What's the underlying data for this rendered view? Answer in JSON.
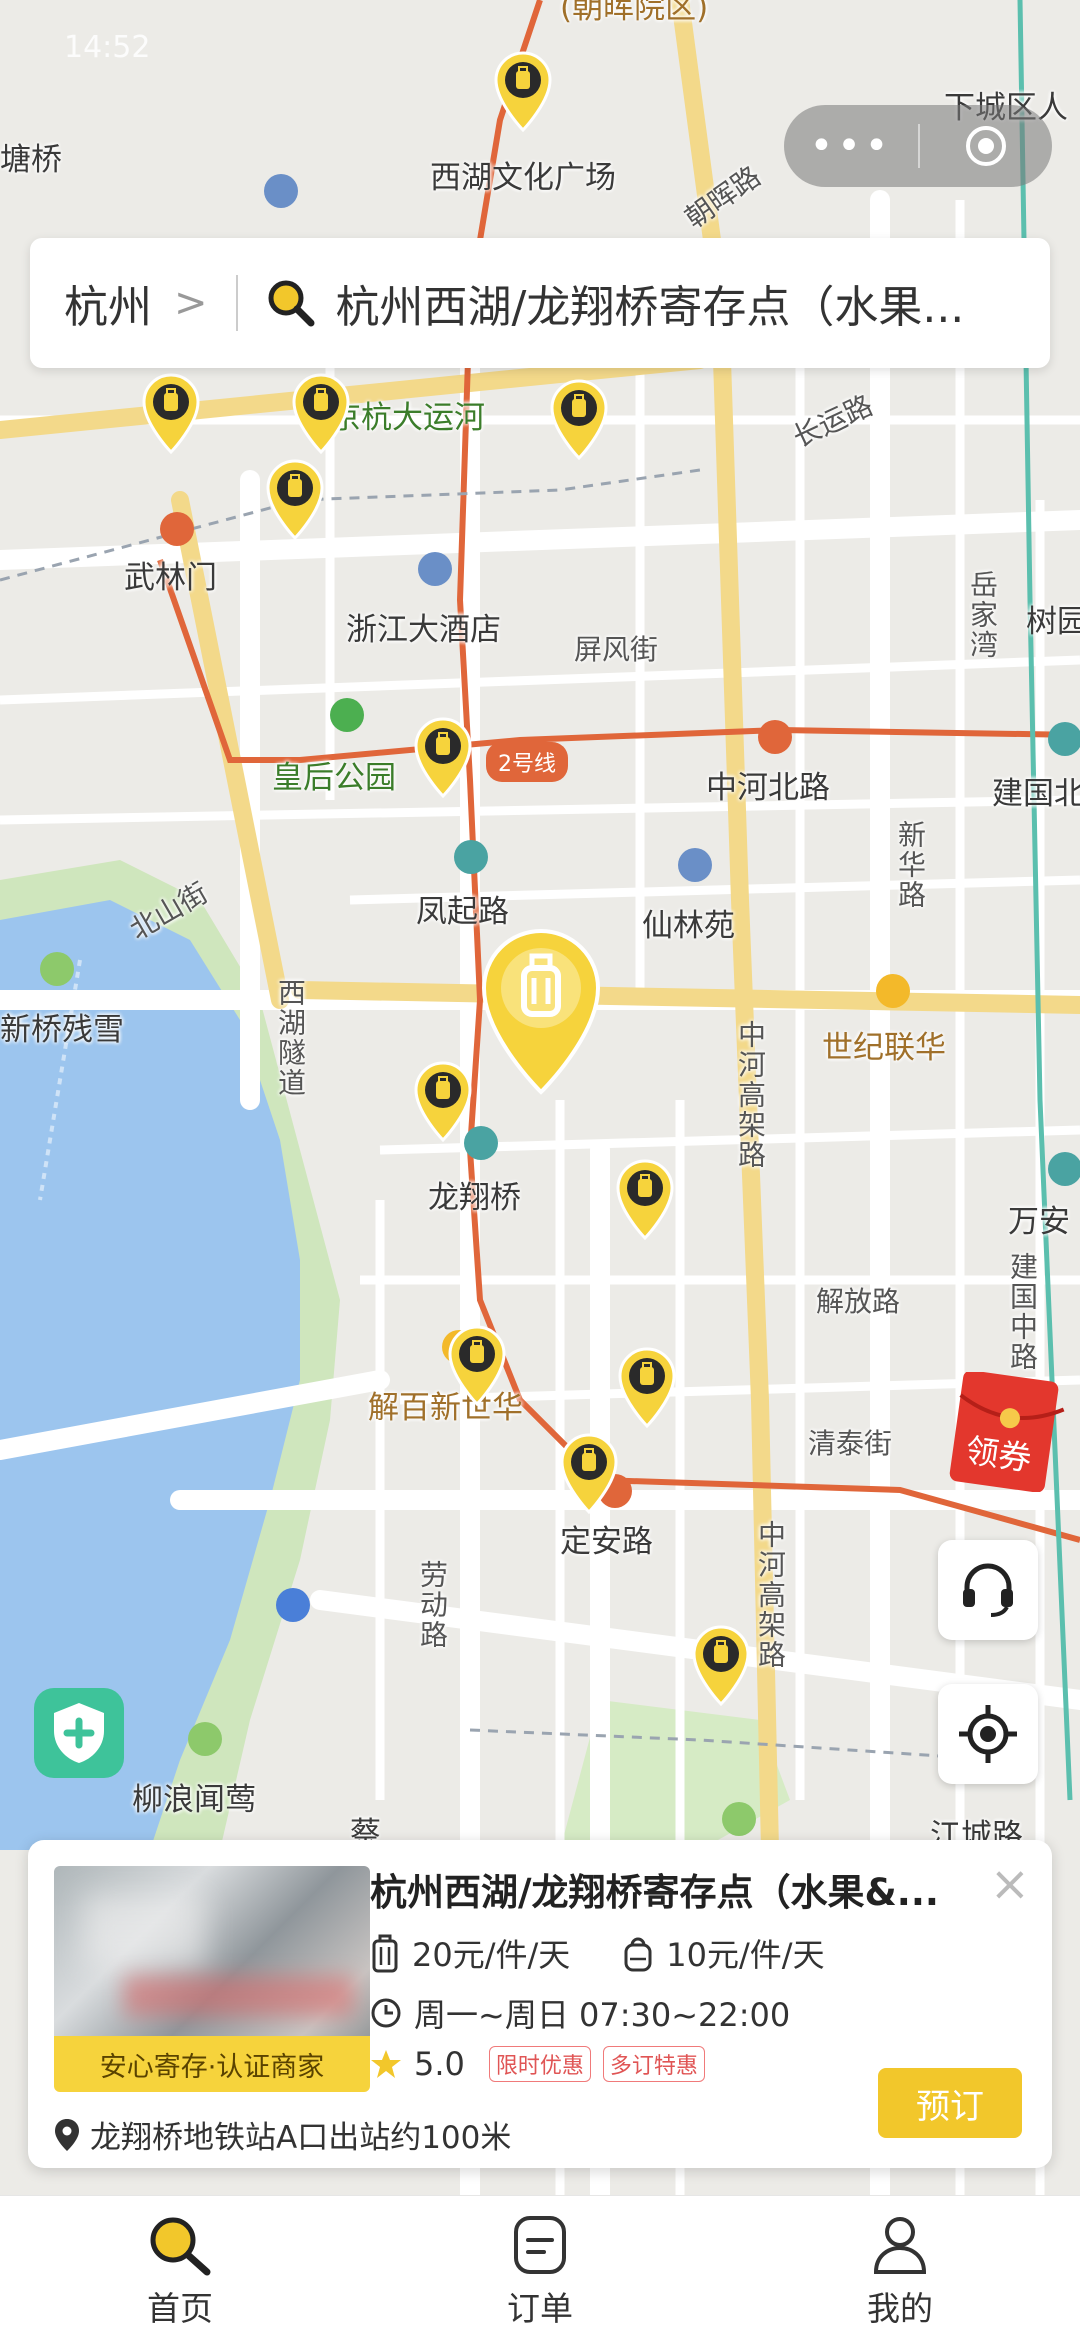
{
  "status": {
    "time": "14:52"
  },
  "capsule": {
    "more": "•••"
  },
  "search": {
    "city": "杭州",
    "chevron": ">",
    "query": "杭州西湖/龙翔桥寄存点（水果..."
  },
  "map_labels": {
    "l01": "(朝晖院区)",
    "l02": "下城区人",
    "l03": "塘桥",
    "l04": "西湖文化广场",
    "l05": "朝晖路",
    "l06": "京杭大运河",
    "l07": "长运路",
    "l08": "武林门",
    "l09": "浙江大酒店",
    "l10": "屏风街",
    "l11": "岳家湾",
    "l12": "树园",
    "l13": "皇后公园",
    "l14": "2号线",
    "l15": "中河北路",
    "l16": "建国北",
    "l17": "新华路",
    "l18": "凤起路",
    "l19": "仙林苑",
    "l20": "北山街",
    "l21": "新桥残雪",
    "l22": "西湖隧道",
    "l23": "世纪联华",
    "l24": "中河高架路",
    "l25": "龙翔桥",
    "l26": "万安",
    "l27": "解放路",
    "l28": "建国中路",
    "l29": "解百新世华",
    "l30": "清泰街",
    "l31": "定安路",
    "l32": "劳动路",
    "l33": "中河高架路",
    "l34": "柳浪闻莺",
    "l35": "江城路",
    "l36": "蔡"
  },
  "coupon": {
    "label": "领券"
  },
  "store_card": {
    "title": "杭州西湖/龙翔桥寄存点（水果&...",
    "trust_badge": "安心寄存·认证商家",
    "price_large": "20元/件/天",
    "price_small": "10元/件/天",
    "hours": "周一~周日 07:30~22:00",
    "rating": "5.0",
    "tags": [
      "限时优惠",
      "多订特惠"
    ],
    "distance": "龙翔桥地铁站A口出站约100米",
    "book_label": "预订",
    "close": "×"
  },
  "tabs": [
    {
      "label": "首页",
      "icon": "search-icon"
    },
    {
      "label": "订单",
      "icon": "order-icon"
    },
    {
      "label": "我的",
      "icon": "user-icon"
    }
  ],
  "colors": {
    "accent": "#f2c72b",
    "pin": "#f6d33c",
    "metro_line": "#e0663a",
    "water": "#9cc5ee",
    "green": "#c7e3b5"
  }
}
